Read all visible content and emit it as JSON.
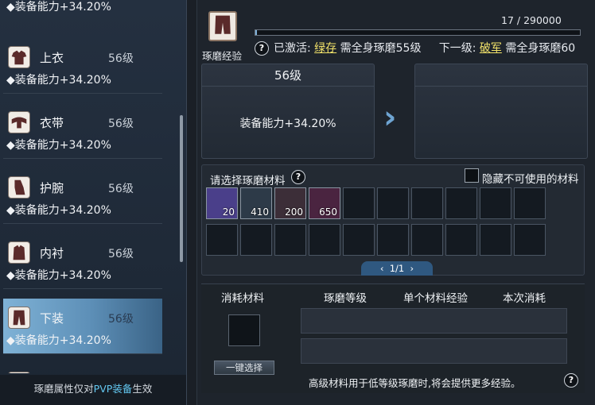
{
  "left": {
    "top_partial_stat": "◆装备能力+34.20%",
    "items": [
      {
        "name": "上衣",
        "level": "56级",
        "stat": "◆装备能力+34.20%",
        "icon": "shirt-icon"
      },
      {
        "name": "衣带",
        "level": "56级",
        "stat": "◆装备能力+34.20%",
        "icon": "belt-icon"
      },
      {
        "name": "护腕",
        "level": "56级",
        "stat": "◆装备能力+34.20%",
        "icon": "bracer-icon"
      },
      {
        "name": "内衬",
        "level": "56级",
        "stat": "◆装备能力+34.20%",
        "icon": "inner-wear-icon"
      },
      {
        "name": "下装",
        "level": "56级",
        "stat": "◆装备能力+34.20%",
        "icon": "pants-icon"
      }
    ],
    "footer": {
      "prefix": "琢磨属性仅对",
      "highlight": "PVP装备",
      "suffix": "生效"
    }
  },
  "right": {
    "exp_label": "琢磨经验",
    "progress_text": "17 / 290000",
    "progress_fraction": 5.86e-05,
    "status": {
      "activated_label": "已激活:",
      "activated_name": "绿存",
      "activated_desc": "需全身琢磨55级",
      "next_label": "下一级:",
      "next_name": "破军",
      "next_desc": "需全身琢磨60"
    },
    "current": {
      "level": "56级",
      "stat": "装备能力+34.20%"
    },
    "materials": {
      "title": "请选择琢磨材料",
      "help": "?",
      "hide_label": "隐藏不可使用的材料",
      "slots": [
        {
          "count": "20",
          "color": "#4a3f8a"
        },
        {
          "count": "410",
          "color": "#2d3a48"
        },
        {
          "count": "200",
          "color": "#3c2e38"
        },
        {
          "count": "650",
          "color": "#4a2440"
        }
      ],
      "pager": "1/1"
    },
    "consume": {
      "col1": "消耗材料",
      "col2": "琢磨等级",
      "col3": "单个材料经验",
      "col4": "本次消耗",
      "button": "一键选择",
      "hint": "高级材料用于低等级琢磨时,将会提供更多经验。"
    }
  }
}
